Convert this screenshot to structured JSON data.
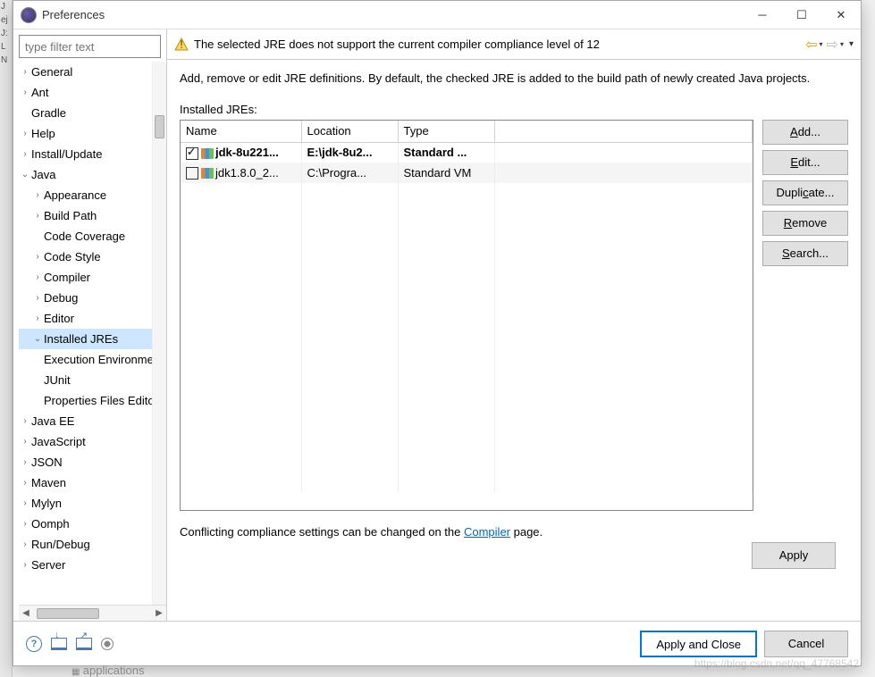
{
  "window": {
    "title": "Preferences"
  },
  "filter_placeholder": "type filter text",
  "tree": [
    {
      "label": "General",
      "indent": 0,
      "twisty": "›"
    },
    {
      "label": "Ant",
      "indent": 0,
      "twisty": "›"
    },
    {
      "label": "Gradle",
      "indent": 0,
      "twisty": ""
    },
    {
      "label": "Help",
      "indent": 0,
      "twisty": "›"
    },
    {
      "label": "Install/Update",
      "indent": 0,
      "twisty": "›"
    },
    {
      "label": "Java",
      "indent": 0,
      "twisty": "⌄"
    },
    {
      "label": "Appearance",
      "indent": 1,
      "twisty": "›"
    },
    {
      "label": "Build Path",
      "indent": 1,
      "twisty": "›"
    },
    {
      "label": "Code Coverage",
      "indent": 1,
      "twisty": ""
    },
    {
      "label": "Code Style",
      "indent": 1,
      "twisty": "›"
    },
    {
      "label": "Compiler",
      "indent": 1,
      "twisty": "›"
    },
    {
      "label": "Debug",
      "indent": 1,
      "twisty": "›"
    },
    {
      "label": "Editor",
      "indent": 1,
      "twisty": "›"
    },
    {
      "label": "Installed JREs",
      "indent": 1,
      "twisty": "⌄",
      "selected": true
    },
    {
      "label": "Execution Environments",
      "indent": 2,
      "twisty": ""
    },
    {
      "label": "JUnit",
      "indent": 1,
      "twisty": ""
    },
    {
      "label": "Properties Files Editor",
      "indent": 1,
      "twisty": ""
    },
    {
      "label": "Java EE",
      "indent": 0,
      "twisty": "›"
    },
    {
      "label": "JavaScript",
      "indent": 0,
      "twisty": "›"
    },
    {
      "label": "JSON",
      "indent": 0,
      "twisty": "›"
    },
    {
      "label": "Maven",
      "indent": 0,
      "twisty": "›"
    },
    {
      "label": "Mylyn",
      "indent": 0,
      "twisty": "›"
    },
    {
      "label": "Oomph",
      "indent": 0,
      "twisty": "›"
    },
    {
      "label": "Run/Debug",
      "indent": 0,
      "twisty": "›"
    },
    {
      "label": "Server",
      "indent": 0,
      "twisty": "›"
    }
  ],
  "warning": "The selected JRE does not support the current compiler compliance level of 12",
  "description": "Add, remove or edit JRE definitions. By default, the checked JRE is added to the build path of newly created Java projects.",
  "list_label": "Installed JREs:",
  "columns": {
    "name": "Name",
    "location": "Location",
    "type": "Type"
  },
  "rows": [
    {
      "checked": true,
      "bold": true,
      "name": "jdk-8u221...",
      "location": "E:\\jdk-8u2...",
      "type": "Standard ..."
    },
    {
      "checked": false,
      "bold": false,
      "name": "jdk1.8.0_2...",
      "location": "C:\\Progra...",
      "type": "Standard VM"
    }
  ],
  "buttons": {
    "add": "Add...",
    "edit": "Edit...",
    "dup": "Duplicate...",
    "remove": "Remove",
    "search": "Search..."
  },
  "underlines": {
    "add": "A",
    "edit": "E",
    "dup": "c",
    "remove": "R",
    "search": "S"
  },
  "conflict_pre": "Conflicting compliance settings can be changed on the ",
  "conflict_link": "Compiler",
  "conflict_post": " page.",
  "apply": "Apply",
  "apply_close": "Apply and Close",
  "cancel": "Cancel",
  "watermark": "https://blog.csdn.net/qq_47768542",
  "footer_snip": "applications"
}
